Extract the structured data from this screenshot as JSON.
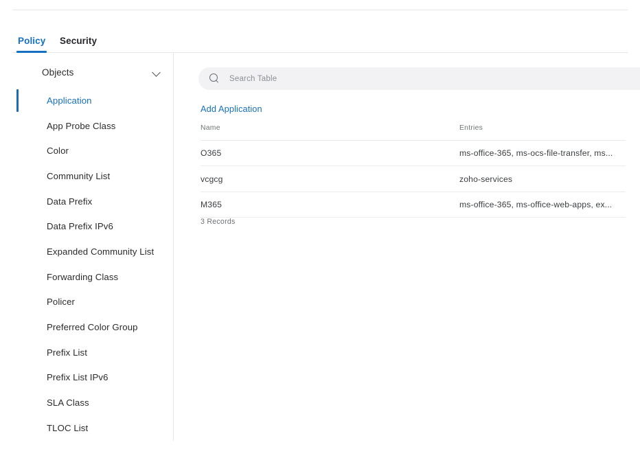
{
  "tabs": [
    {
      "id": "policy",
      "label": "Policy",
      "active": true
    },
    {
      "id": "security",
      "label": "Security",
      "active": false
    }
  ],
  "sidebar": {
    "header": {
      "label": "Objects",
      "icon": "chevron-down-icon",
      "expanded": true
    },
    "items": [
      {
        "label": "Application",
        "active": true
      },
      {
        "label": "App Probe Class",
        "active": false
      },
      {
        "label": "Color",
        "active": false
      },
      {
        "label": "Community List",
        "active": false
      },
      {
        "label": "Data Prefix",
        "active": false
      },
      {
        "label": "Data Prefix IPv6",
        "active": false
      },
      {
        "label": "Expanded Community List",
        "active": false
      },
      {
        "label": "Forwarding Class",
        "active": false
      },
      {
        "label": "Policer",
        "active": false
      },
      {
        "label": "Preferred Color Group",
        "active": false
      },
      {
        "label": "Prefix List",
        "active": false
      },
      {
        "label": "Prefix List IPv6",
        "active": false
      },
      {
        "label": "SLA Class",
        "active": false
      },
      {
        "label": "TLOC List",
        "active": false
      }
    ]
  },
  "main": {
    "search": {
      "placeholder": "Search Table",
      "value": "",
      "icon": "search-icon"
    },
    "add_button_label": "Add Application",
    "table": {
      "columns": [
        {
          "key": "name",
          "label": "Name"
        },
        {
          "key": "entries",
          "label": "Entries"
        }
      ],
      "rows": [
        {
          "name": "O365",
          "entries": "ms-office-365, ms-ocs-file-transfer, ms..."
        },
        {
          "name": "vcgcg",
          "entries": "zoho-services"
        },
        {
          "name": "M365",
          "entries": "ms-office-365, ms-office-web-apps, ex..."
        }
      ],
      "record_count_label": "3 Records"
    }
  },
  "colors": {
    "accent": "#1670c2",
    "active_indicator": "#1c6cb5",
    "text": "#2b2b2b",
    "muted_text": "#6e7276",
    "divider": "#e4e6e8",
    "search_bg": "#f2f2f4"
  }
}
